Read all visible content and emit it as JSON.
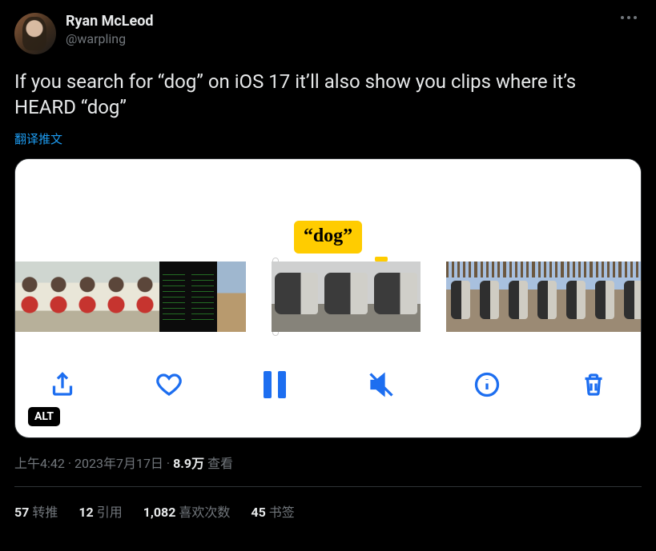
{
  "user": {
    "display_name": "Ryan McLeod",
    "handle": "@warpling"
  },
  "tweet": {
    "text": "If you search for “dog” on iOS 17 it’ll also show you clips where it’s HEARD “dog”",
    "translate_label": "翻译推文"
  },
  "media": {
    "keyword_label": "“dog”",
    "alt_badge": "ALT",
    "toolbar_icons": [
      "share-icon",
      "heart-icon",
      "pause-icon",
      "mute-icon",
      "info-icon",
      "trash-icon"
    ]
  },
  "meta": {
    "time": "上午4:42",
    "dot1": " · ",
    "date": "2023年7月17日",
    "dot2": " · ",
    "views_count": "8.9万",
    "views_label": " 查看"
  },
  "stats": {
    "retweets": {
      "count": "57",
      "label": "转推"
    },
    "quotes": {
      "count": "12",
      "label": "引用"
    },
    "likes": {
      "count": "1,082",
      "label": "喜欢次数"
    },
    "bookmarks": {
      "count": "45",
      "label": "书签"
    }
  }
}
